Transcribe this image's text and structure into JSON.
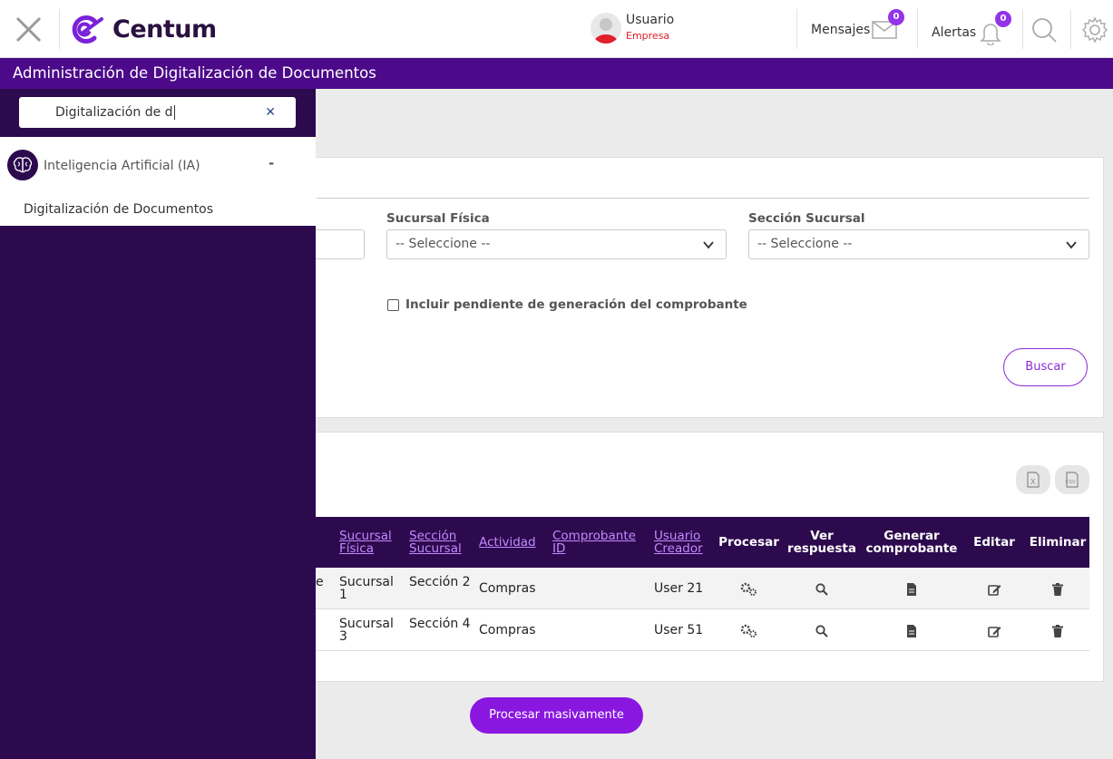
{
  "header": {
    "brand": "Centum",
    "user_name": "Usuario",
    "user_company": "Empresa",
    "messages_label": "Mensajes",
    "messages_count": "0",
    "alerts_label": "Alertas",
    "alerts_count": "0"
  },
  "page": {
    "title": "Administración de Digitalización de Documentos"
  },
  "filters": {
    "sucursal_fisica_label": "Sucursal Física",
    "sucursal_fisica_value": "-- Seleccione --",
    "seccion_sucursal_label": "Sección Sucursal",
    "seccion_sucursal_value": "-- Seleccione --",
    "include_pending_label": "Incluir pendiente de generación del comprobante",
    "include_pending_checked": false,
    "search_button": "Buscar"
  },
  "table": {
    "columns": {
      "sucursal_fisica": "Sucursal Física",
      "seccion_sucursal": "Sección Sucursal",
      "actividad": "Actividad",
      "comprobante_id": "Comprobante ID",
      "usuario_creador": "Usuario Creador",
      "procesar": "Procesar",
      "ver_respuesta": "Ver respuesta",
      "generar_comprobante": "Generar comprobante",
      "editar": "Editar",
      "eliminar": "Eliminar"
    },
    "rows": [
      {
        "partial": "e",
        "sucursal": "Sucursal 1",
        "seccion": "Sección 2",
        "actividad": "Compras",
        "comprobante": "",
        "usuario": "User 21"
      },
      {
        "partial": "",
        "sucursal": "Sucursal 3",
        "seccion": "Sección 4",
        "actividad": "Compras",
        "comprobante": "",
        "usuario": "User 51"
      }
    ],
    "export_icons": [
      "excel-export-icon",
      "csv-export-icon"
    ]
  },
  "actions": {
    "bulk_process": "Procesar masivamente"
  },
  "sidebar": {
    "search_value": "Digitalización de d",
    "group_label": "Inteligencia Artificial (IA)",
    "group_toggle": "-",
    "items": [
      {
        "label": "Digitalización de Documentos"
      }
    ]
  },
  "colors": {
    "brand_purple": "#4c0a8a",
    "sidebar_dark": "#2d0a4d",
    "accent": "#8a17e0",
    "link": "#c389ff",
    "company_red": "#e0202a"
  }
}
